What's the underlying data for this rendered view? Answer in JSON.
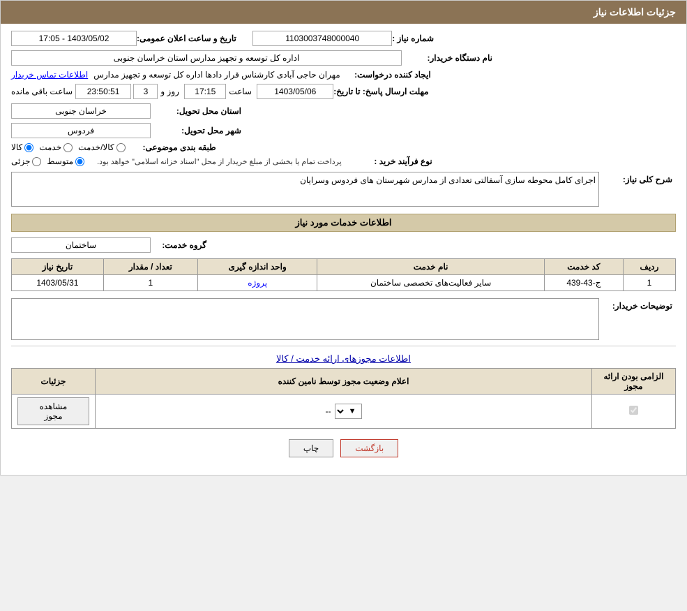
{
  "header": {
    "title": "جزئیات اطلاعات نیاز"
  },
  "form": {
    "need_number_label": "شماره نیاز :",
    "need_number_value": "1103003748000040",
    "announcement_date_label": "تاریخ و ساعت اعلان عمومی:",
    "announcement_date_value": "1403/05/02 - 17:05",
    "buyer_org_label": "نام دستگاه خریدار:",
    "buyer_org_value": "اداره کل توسعه  و تجهیز مدارس استان خراسان جنوبی",
    "requester_label": "ایجاد کننده درخواست:",
    "requester_name": "مهران حاجی آبادی کارشناس قرار دادها اداره کل توسعه  و تجهیز مدارس",
    "contact_info_link": "اطلاعات تماس خریدار",
    "response_deadline_label": "مهلت ارسال پاسخ: تا تاریخ:",
    "response_date_value": "1403/05/06",
    "response_time_label": "ساعت",
    "response_time_value": "17:15",
    "response_days_label": "روز و",
    "response_days_value": "3",
    "response_remaining_label": "ساعت باقی مانده",
    "response_remaining_value": "23:50:51",
    "province_label": "استان محل تحویل:",
    "province_value": "خراسان جنوبی",
    "city_label": "شهر محل تحویل:",
    "city_value": "فردوس",
    "category_label": "طبقه بندی موضوعی:",
    "radio_kala": "کالا",
    "radio_khedmat": "خدمت",
    "radio_kala_khedmat": "کالا/خدمت",
    "purchase_type_label": "نوع فرآیند خرید :",
    "radio_jozei": "جزئی",
    "radio_motavaset": "متوسط",
    "purchase_note": "پرداخت تمام یا بخشی از مبلغ خریدار از محل \"اسناد خزانه اسلامی\" خواهد بود.",
    "description_label": "شرح کلی نیاز:",
    "description_value": "اجرای کامل محوطه سازی آسفالتی تعدادی از مدارس شهرستان های فردوس  وسرایان",
    "services_section_title": "اطلاعات خدمات مورد نیاز",
    "service_group_label": "گروه خدمت:",
    "service_group_value": "ساختمان",
    "table": {
      "headers": [
        "ردیف",
        "کد خدمت",
        "نام خدمت",
        "واحد اندازه گیری",
        "تعداد / مقدار",
        "تاریخ نیاز"
      ],
      "rows": [
        {
          "row_num": "1",
          "service_code": "ج-43-439",
          "service_name": "سایر فعالیت‌های تخصصی ساختمان",
          "unit": "پروژه",
          "quantity": "1",
          "need_date": "1403/05/31"
        }
      ]
    },
    "buyer_notes_label": "توضیحات خریدار:",
    "buyer_notes_value": "",
    "permissions_section_title": "اطلاعات مجوزهای ارائه خدمت / کالا",
    "permissions_table": {
      "headers": [
        "الزامی بودن ارائه مجوز",
        "اعلام وضعیت مجوز توسط نامین کننده",
        "جزئیات"
      ],
      "rows": [
        {
          "required": true,
          "status": "--",
          "details_btn": "مشاهده مجوز"
        }
      ]
    }
  },
  "buttons": {
    "print": "چاپ",
    "back": "بازگشت"
  }
}
